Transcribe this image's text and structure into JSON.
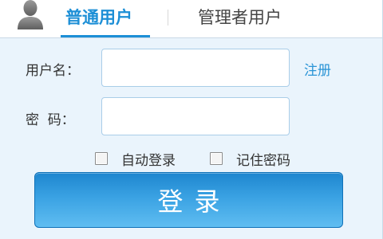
{
  "tabs": {
    "active_label": "普通用户",
    "inactive_label": "管理者用户"
  },
  "form": {
    "username_label": "用户名：",
    "password_label": "密  码：",
    "username_value": "",
    "password_value": "",
    "register_link": "注册",
    "auto_login_label": "自动登录",
    "remember_password_label": "记住密码",
    "auto_login_checked": false,
    "remember_password_checked": false
  },
  "login_button": {
    "label": "登录"
  },
  "colors": {
    "accent": "#1d8fd6",
    "panel_background": "#eaf4fc",
    "button_top": "#1e86cf",
    "button_bottom": "#5fbdf1"
  },
  "icons": {
    "user_avatar": "user-silhouette-icon"
  }
}
